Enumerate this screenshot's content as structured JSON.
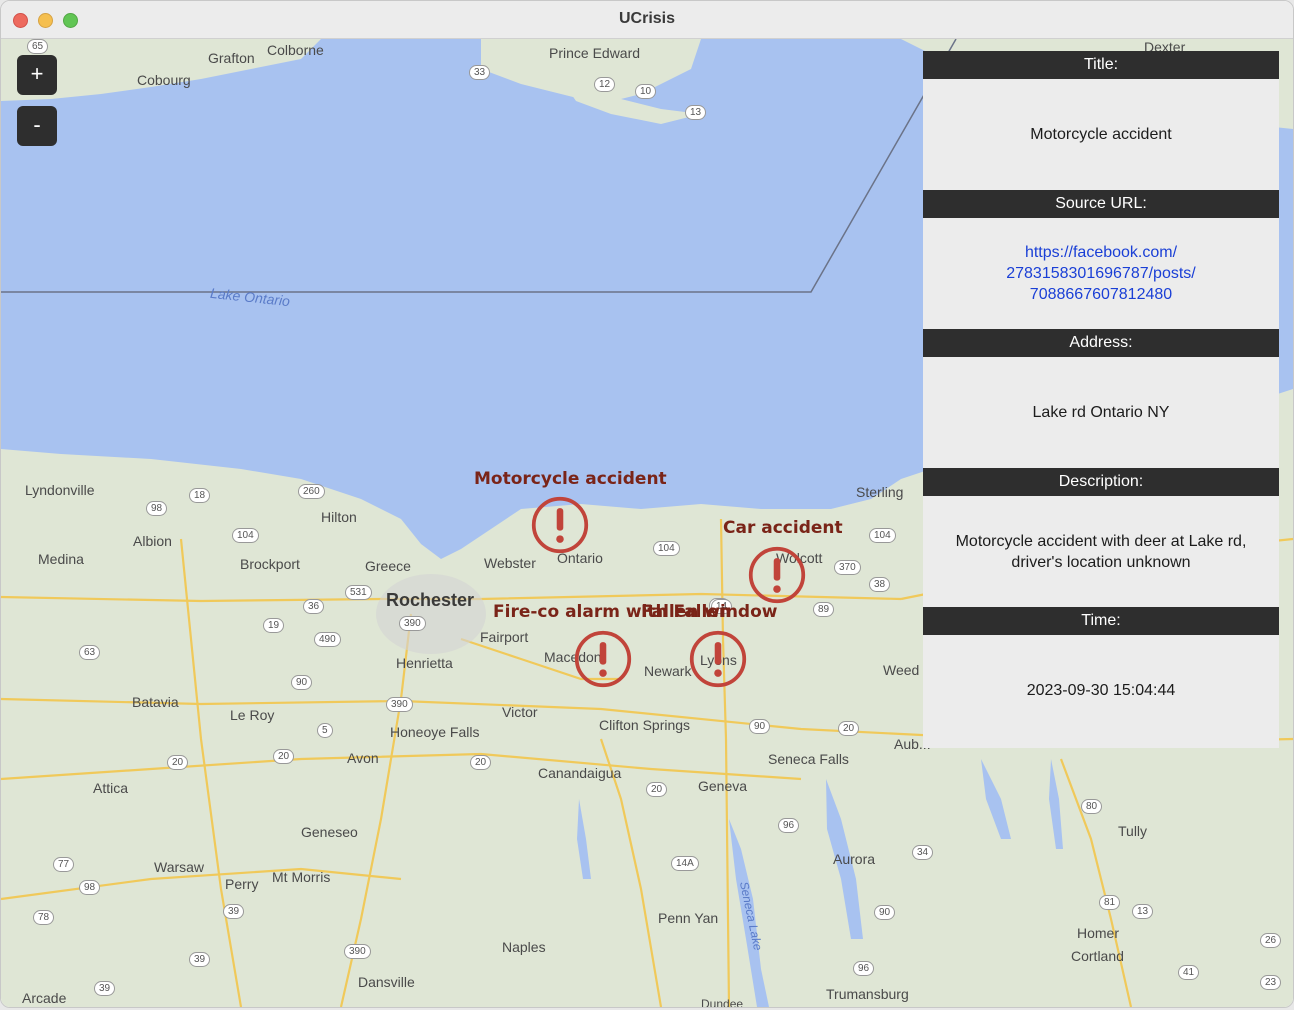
{
  "window": {
    "title": "UCrisis"
  },
  "zoom": {
    "in_label": "+",
    "out_label": "-"
  },
  "map": {
    "places": [
      {
        "id": "grafton",
        "name": "Grafton"
      },
      {
        "id": "colborne",
        "name": "Colborne"
      },
      {
        "id": "cobourg",
        "name": "Cobourg"
      },
      {
        "id": "prince-edward",
        "name": "Prince Edward"
      },
      {
        "id": "dexter",
        "name": "Dexter"
      },
      {
        "id": "lake-ontario",
        "name": "Lake Ontario"
      },
      {
        "id": "lyndonville",
        "name": "Lyndonville"
      },
      {
        "id": "hilton",
        "name": "Hilton"
      },
      {
        "id": "albion",
        "name": "Albion"
      },
      {
        "id": "medina",
        "name": "Medina"
      },
      {
        "id": "brockport",
        "name": "Brockport"
      },
      {
        "id": "greece",
        "name": "Greece"
      },
      {
        "id": "webster",
        "name": "Webster"
      },
      {
        "id": "ontario",
        "name": "Ontario"
      },
      {
        "id": "rochester",
        "name": "Rochester"
      },
      {
        "id": "fairport",
        "name": "Fairport"
      },
      {
        "id": "macedon",
        "name": "Macedon"
      },
      {
        "id": "newark",
        "name": "Newark"
      },
      {
        "id": "lyons",
        "name": "Lyons"
      },
      {
        "id": "wolcott",
        "name": "Wolcott"
      },
      {
        "id": "sterling",
        "name": "Sterling"
      },
      {
        "id": "henrietta",
        "name": "Henrietta"
      },
      {
        "id": "batavia",
        "name": "Batavia"
      },
      {
        "id": "le-roy",
        "name": "Le Roy"
      },
      {
        "id": "victor",
        "name": "Victor"
      },
      {
        "id": "honeoye-falls",
        "name": "Honeoye Falls"
      },
      {
        "id": "clifton-springs",
        "name": "Clifton Springs"
      },
      {
        "id": "avon",
        "name": "Avon"
      },
      {
        "id": "canandaigua",
        "name": "Canandaigua"
      },
      {
        "id": "geneva",
        "name": "Geneva"
      },
      {
        "id": "seneca-falls",
        "name": "Seneca Falls"
      },
      {
        "id": "auburn",
        "name": "Aub..."
      },
      {
        "id": "weed",
        "name": "Weed"
      },
      {
        "id": "attica",
        "name": "Attica"
      },
      {
        "id": "geneseo",
        "name": "Geneseo"
      },
      {
        "id": "warsaw",
        "name": "Warsaw"
      },
      {
        "id": "perry",
        "name": "Perry"
      },
      {
        "id": "mt-morris",
        "name": "Mt Morris"
      },
      {
        "id": "aurora",
        "name": "Aurora"
      },
      {
        "id": "tully",
        "name": "Tully"
      },
      {
        "id": "penn-yan",
        "name": "Penn Yan"
      },
      {
        "id": "seneca-lake",
        "name": "Seneca Lake"
      },
      {
        "id": "naples",
        "name": "Naples"
      },
      {
        "id": "homer",
        "name": "Homer"
      },
      {
        "id": "cortland",
        "name": "Cortland"
      },
      {
        "id": "dansville",
        "name": "Dansville"
      },
      {
        "id": "arcade",
        "name": "Arcade"
      },
      {
        "id": "trumansburg",
        "name": "Trumansburg"
      },
      {
        "id": "dundee",
        "name": "Dundee"
      }
    ],
    "routes": [
      "65",
      "33",
      "12",
      "10",
      "13",
      "98",
      "18",
      "260",
      "104",
      "104",
      "104",
      "531",
      "36",
      "490",
      "390",
      "19",
      "63",
      "90",
      "390",
      "31",
      "5",
      "20",
      "20",
      "20",
      "14",
      "89",
      "370",
      "38",
      "90",
      "20",
      "20",
      "96",
      "14A",
      "90",
      "34",
      "80",
      "81",
      "13",
      "26",
      "23",
      "41",
      "77",
      "98",
      "78",
      "39",
      "390",
      "39",
      "39",
      "96"
    ],
    "accent_marker_color": "#c1443a",
    "water_color": "#a8c2f0",
    "land_color": "#dfe6d5"
  },
  "incidents": [
    {
      "label": "Motorcycle accident"
    },
    {
      "label": "Car accident"
    },
    {
      "label": "Fire-co alarm with Fallen"
    },
    {
      "label": "Fallen window"
    }
  ],
  "panel": {
    "title_header": "Title:",
    "title_value": "Motorcycle accident",
    "url_header": "Source URL:",
    "url_value": "https://facebook.com/\n2783158301696787/posts/\n7088667607812480",
    "address_header": "Address:",
    "address_value": "Lake rd Ontario NY",
    "description_header": "Description:",
    "description_value": "Motorcycle accident with deer at Lake rd, driver's location unknown",
    "time_header": "Time:",
    "time_value": "2023-09-30 15:04:44"
  }
}
